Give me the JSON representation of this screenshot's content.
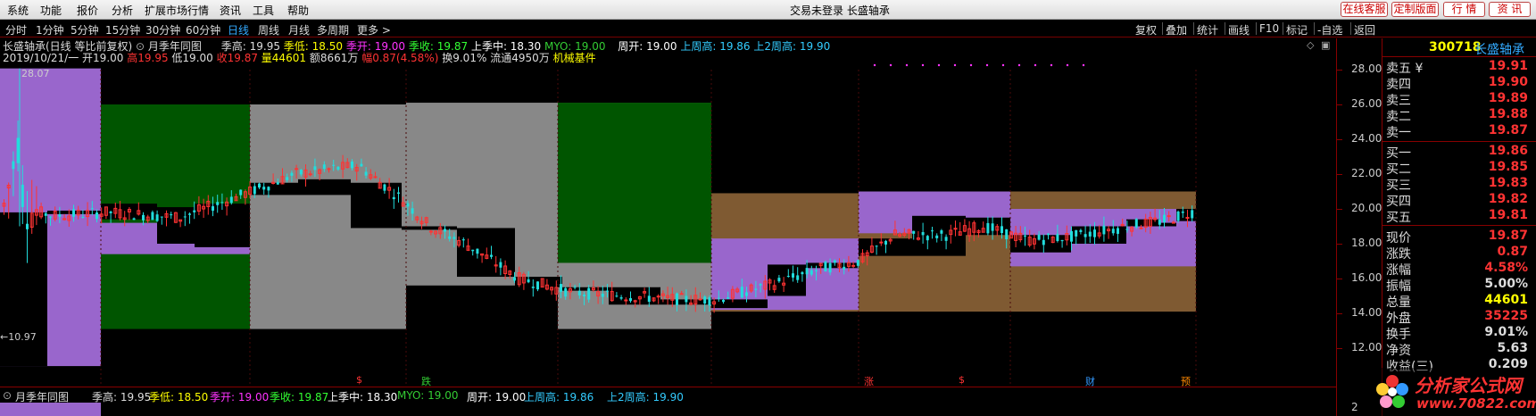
{
  "menu": [
    "系统",
    "功能",
    "报价",
    "分析",
    "扩展市场行情",
    "资讯",
    "工具",
    "帮助"
  ],
  "title_center": "交易未登录  长盛轴承",
  "right_buttons": [
    "在线客服",
    "定制版面",
    "行 情",
    "资 讯"
  ],
  "periods": [
    "分时",
    "1分钟",
    "5分钟",
    "15分钟",
    "30分钟",
    "60分钟",
    "日线",
    "周线",
    "月线",
    "多周期",
    "更多 >"
  ],
  "active_period": "日线",
  "right_tools": [
    "复权",
    "叠加",
    "统计",
    "画线",
    "F10",
    "标记",
    "-自选",
    "返回"
  ],
  "info": {
    "name": "长盛轴承(日线 等比前复权)",
    "indicator": "月季年同图",
    "q_high_label": "季高: 19.95",
    "q_low_label": "季低: 18.50",
    "q_open_label": "季开: 19.00",
    "q_close_label": "季收: 19.87",
    "lastq_mid_label": "上季中: 18.30",
    "myo_label": "MYO: 19.00",
    "week_open_label": "周开: 19.00",
    "last_week_high_label": "上周高: 19.86",
    "last2_week_high_label": "上2周高: 19.90",
    "date": "2019/10/21/一",
    "open": "开19.00",
    "high": "高19.95",
    "low": "低19.00",
    "close": "收19.87",
    "vol": "量44601",
    "amt": "额8661万",
    "chg": "幅0.87(4.58%)",
    "turn": "换9.01%",
    "float": "流通4950万",
    "sector": "机械基件",
    "max_label": "28.07",
    "min_label": "←10.97"
  },
  "markers": [
    {
      "text": "$",
      "color": "#f33"
    },
    {
      "text": "跌",
      "color": "#3c3"
    },
    {
      "text": "涨",
      "color": "#f33"
    },
    {
      "text": "$",
      "color": "#f33"
    },
    {
      "text": "财",
      "color": "#39f"
    },
    {
      "text": "预",
      "color": "#f80"
    }
  ],
  "axis_ticks": [
    "28.00",
    "26.00",
    "24.00",
    "22.00",
    "20.00",
    "18.00",
    "16.00",
    "14.00",
    "12.00"
  ],
  "sub_axis_tick": "2",
  "quote": {
    "code": "300718",
    "name": "长盛轴承",
    "sells": [
      {
        "label": "卖五 ¥",
        "price": "19.91"
      },
      {
        "label": "卖四",
        "price": "19.90"
      },
      {
        "label": "卖三",
        "price": "19.89"
      },
      {
        "label": "卖二",
        "price": "19.88"
      },
      {
        "label": "卖一",
        "price": "19.87"
      }
    ],
    "buys": [
      {
        "label": "买一",
        "price": "19.86"
      },
      {
        "label": "买二",
        "price": "19.85"
      },
      {
        "label": "买三",
        "price": "19.83"
      },
      {
        "label": "买四",
        "price": "19.82"
      },
      {
        "label": "买五",
        "price": "19.81"
      }
    ],
    "stats": [
      {
        "label": "现价",
        "value": "19.87",
        "color": "#f33"
      },
      {
        "label": "涨跌",
        "value": "0.87",
        "color": "#f33"
      },
      {
        "label": "涨幅",
        "value": "4.58%",
        "color": "#f33"
      },
      {
        "label": "振幅",
        "value": "5.00%",
        "color": "#ddd"
      },
      {
        "label": "总量",
        "value": "44601",
        "color": "#ff0"
      },
      {
        "label": "外盘",
        "value": "35225",
        "color": "#f33"
      },
      {
        "label": "换手",
        "value": "9.01%",
        "color": "#ddd"
      },
      {
        "label": "净资",
        "value": "5.63",
        "color": "#ddd"
      },
      {
        "label": "收益(三)",
        "value": "0.209",
        "color": "#ddd"
      }
    ]
  },
  "watermark": {
    "line1": "分析家公式网",
    "line2": "www.70822.com"
  },
  "colors": {
    "purple": "#9966cc",
    "green": "#005500",
    "gray": "#888888",
    "brown": "#7f5a32",
    "teal": "#129898",
    "maroon": "#5a0a26",
    "up": "#ff3333",
    "down": "#22dddd"
  }
}
